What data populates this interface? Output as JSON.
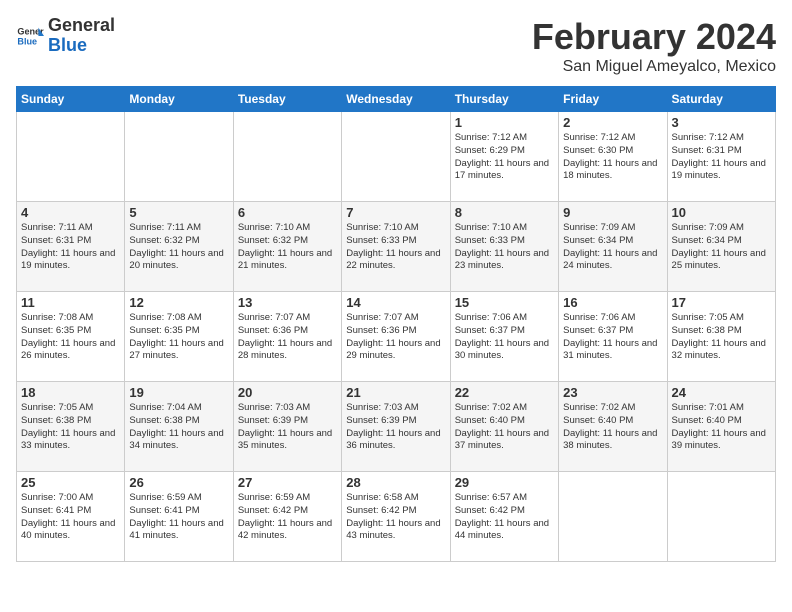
{
  "header": {
    "logo_general": "General",
    "logo_blue": "Blue",
    "month_title": "February 2024",
    "location": "San Miguel Ameyalco, Mexico"
  },
  "days_of_week": [
    "Sunday",
    "Monday",
    "Tuesday",
    "Wednesday",
    "Thursday",
    "Friday",
    "Saturday"
  ],
  "weeks": [
    [
      {
        "day": "",
        "info": ""
      },
      {
        "day": "",
        "info": ""
      },
      {
        "day": "",
        "info": ""
      },
      {
        "day": "",
        "info": ""
      },
      {
        "day": "1",
        "info": "Sunrise: 7:12 AM\nSunset: 6:29 PM\nDaylight: 11 hours\nand 17 minutes."
      },
      {
        "day": "2",
        "info": "Sunrise: 7:12 AM\nSunset: 6:30 PM\nDaylight: 11 hours\nand 18 minutes."
      },
      {
        "day": "3",
        "info": "Sunrise: 7:12 AM\nSunset: 6:31 PM\nDaylight: 11 hours\nand 19 minutes."
      }
    ],
    [
      {
        "day": "4",
        "info": "Sunrise: 7:11 AM\nSunset: 6:31 PM\nDaylight: 11 hours\nand 19 minutes."
      },
      {
        "day": "5",
        "info": "Sunrise: 7:11 AM\nSunset: 6:32 PM\nDaylight: 11 hours\nand 20 minutes."
      },
      {
        "day": "6",
        "info": "Sunrise: 7:10 AM\nSunset: 6:32 PM\nDaylight: 11 hours\nand 21 minutes."
      },
      {
        "day": "7",
        "info": "Sunrise: 7:10 AM\nSunset: 6:33 PM\nDaylight: 11 hours\nand 22 minutes."
      },
      {
        "day": "8",
        "info": "Sunrise: 7:10 AM\nSunset: 6:33 PM\nDaylight: 11 hours\nand 23 minutes."
      },
      {
        "day": "9",
        "info": "Sunrise: 7:09 AM\nSunset: 6:34 PM\nDaylight: 11 hours\nand 24 minutes."
      },
      {
        "day": "10",
        "info": "Sunrise: 7:09 AM\nSunset: 6:34 PM\nDaylight: 11 hours\nand 25 minutes."
      }
    ],
    [
      {
        "day": "11",
        "info": "Sunrise: 7:08 AM\nSunset: 6:35 PM\nDaylight: 11 hours\nand 26 minutes."
      },
      {
        "day": "12",
        "info": "Sunrise: 7:08 AM\nSunset: 6:35 PM\nDaylight: 11 hours\nand 27 minutes."
      },
      {
        "day": "13",
        "info": "Sunrise: 7:07 AM\nSunset: 6:36 PM\nDaylight: 11 hours\nand 28 minutes."
      },
      {
        "day": "14",
        "info": "Sunrise: 7:07 AM\nSunset: 6:36 PM\nDaylight: 11 hours\nand 29 minutes."
      },
      {
        "day": "15",
        "info": "Sunrise: 7:06 AM\nSunset: 6:37 PM\nDaylight: 11 hours\nand 30 minutes."
      },
      {
        "day": "16",
        "info": "Sunrise: 7:06 AM\nSunset: 6:37 PM\nDaylight: 11 hours\nand 31 minutes."
      },
      {
        "day": "17",
        "info": "Sunrise: 7:05 AM\nSunset: 6:38 PM\nDaylight: 11 hours\nand 32 minutes."
      }
    ],
    [
      {
        "day": "18",
        "info": "Sunrise: 7:05 AM\nSunset: 6:38 PM\nDaylight: 11 hours\nand 33 minutes."
      },
      {
        "day": "19",
        "info": "Sunrise: 7:04 AM\nSunset: 6:38 PM\nDaylight: 11 hours\nand 34 minutes."
      },
      {
        "day": "20",
        "info": "Sunrise: 7:03 AM\nSunset: 6:39 PM\nDaylight: 11 hours\nand 35 minutes."
      },
      {
        "day": "21",
        "info": "Sunrise: 7:03 AM\nSunset: 6:39 PM\nDaylight: 11 hours\nand 36 minutes."
      },
      {
        "day": "22",
        "info": "Sunrise: 7:02 AM\nSunset: 6:40 PM\nDaylight: 11 hours\nand 37 minutes."
      },
      {
        "day": "23",
        "info": "Sunrise: 7:02 AM\nSunset: 6:40 PM\nDaylight: 11 hours\nand 38 minutes."
      },
      {
        "day": "24",
        "info": "Sunrise: 7:01 AM\nSunset: 6:40 PM\nDaylight: 11 hours\nand 39 minutes."
      }
    ],
    [
      {
        "day": "25",
        "info": "Sunrise: 7:00 AM\nSunset: 6:41 PM\nDaylight: 11 hours\nand 40 minutes."
      },
      {
        "day": "26",
        "info": "Sunrise: 6:59 AM\nSunset: 6:41 PM\nDaylight: 11 hours\nand 41 minutes."
      },
      {
        "day": "27",
        "info": "Sunrise: 6:59 AM\nSunset: 6:42 PM\nDaylight: 11 hours\nand 42 minutes."
      },
      {
        "day": "28",
        "info": "Sunrise: 6:58 AM\nSunset: 6:42 PM\nDaylight: 11 hours\nand 43 minutes."
      },
      {
        "day": "29",
        "info": "Sunrise: 6:57 AM\nSunset: 6:42 PM\nDaylight: 11 hours\nand 44 minutes."
      },
      {
        "day": "",
        "info": ""
      },
      {
        "day": "",
        "info": ""
      }
    ]
  ]
}
